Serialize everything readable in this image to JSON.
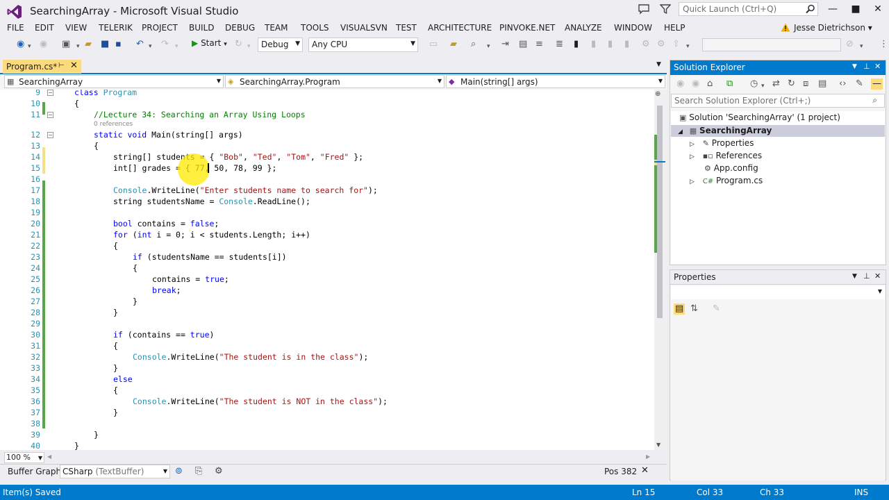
{
  "window": {
    "title": "SearchingArray - Microsoft Visual Studio",
    "quick_launch_placeholder": "Quick Launch (Ctrl+Q)"
  },
  "menu": {
    "items": [
      "FILE",
      "EDIT",
      "VIEW",
      "TELERIK",
      "PROJECT",
      "BUILD",
      "DEBUG",
      "TEAM",
      "TOOLS",
      "VISUALSVN",
      "TEST",
      "ARCHITECTURE",
      "PINVOKE.NET",
      "ANALYZE",
      "WINDOW",
      "HELP"
    ],
    "user": "Jesse Dietrichson"
  },
  "toolbar": {
    "start_label": "Start",
    "configuration": "Debug",
    "platform": "Any CPU"
  },
  "editor": {
    "active_tab": "Program.cs*",
    "nav_project": "SearchingArray",
    "nav_class": "SearchingArray.Program",
    "nav_member": "Main(string[] args)",
    "zoom": "100 %",
    "lines": [
      {
        "num": "9"
      },
      {
        "num": "10"
      },
      {
        "num": "11"
      },
      {
        "num": "12"
      },
      {
        "num": "13"
      },
      {
        "num": "14"
      },
      {
        "num": "15"
      },
      {
        "num": "16"
      },
      {
        "num": "17"
      },
      {
        "num": "18"
      },
      {
        "num": "19"
      },
      {
        "num": "20"
      },
      {
        "num": "21"
      },
      {
        "num": "22"
      },
      {
        "num": "23"
      },
      {
        "num": "24"
      },
      {
        "num": "25"
      },
      {
        "num": "26"
      },
      {
        "num": "27"
      },
      {
        "num": "28"
      },
      {
        "num": "29"
      },
      {
        "num": "30"
      },
      {
        "num": "31"
      },
      {
        "num": "32"
      },
      {
        "num": "33"
      },
      {
        "num": "34"
      },
      {
        "num": "35"
      },
      {
        "num": "36"
      },
      {
        "num": "37"
      },
      {
        "num": "38"
      },
      {
        "num": "39"
      },
      {
        "num": "40"
      }
    ],
    "code": {
      "l9_kw": "class",
      "l9_ty": "Program",
      "l10": "{",
      "l11": "//Lecture 34: Searching an Array Using Loops",
      "references": "0 references",
      "l12_kw1": "static",
      "l12_kw2": "void",
      "l12_rest": "Main(string[] args)",
      "l13": "{",
      "l14_a": "string[] students = { ",
      "l14_s1": "\"Bob\"",
      "l14_s2": "\"Ted\"",
      "l14_s3": "\"Tom\"",
      "l14_s4": "\"Fred\"",
      "l14_end": " };",
      "l15": "int[] grades = { 77, 50, 78, 99 };",
      "l17_ty": "Console",
      "l17_mid": ".WriteLine(",
      "l17_s": "\"Enter students name to search for\"",
      "l17_end": ");",
      "l18_a": "string studentsName = ",
      "l18_ty": "Console",
      "l18_end": ".ReadLine();",
      "l20_kw": "bool",
      "l20_mid": " contains = ",
      "l20_kw2": "false",
      "l20_end": ";",
      "l21_kw": "for",
      "l21_a": " (",
      "l21_kw2": "int",
      "l21_end": " i = 0; i < students.Length; i++)",
      "l22": "{",
      "l23_kw": "if",
      "l23_end": " (studentsName == students[i])",
      "l24": "{",
      "l25_a": "contains = ",
      "l25_kw": "true",
      "l25_end": ";",
      "l26_kw": "break",
      "l26_end": ";",
      "l27": "}",
      "l28": "}",
      "l30_kw": "if",
      "l30_a": " (contains == ",
      "l30_kw2": "true",
      "l30_end": ")",
      "l31": "{",
      "l32_ty": "Console",
      "l32_mid": ".WriteLine(",
      "l32_s": "\"The student is in the class\"",
      "l32_end": ");",
      "l33": "}",
      "l34_kw": "else",
      "l35": "{",
      "l36_ty": "Console",
      "l36_mid": ".WriteLine(",
      "l36_s": "\"The student is NOT in the class\"",
      "l36_end": ");",
      "l37": "}",
      "l39": "}",
      "l40": "}"
    }
  },
  "buffer": {
    "label": "Buffer Graph:",
    "value": "CSharp",
    "value_sub": "(TextBuffer)",
    "pos": "Pos 382"
  },
  "solution_explorer": {
    "title": "Solution Explorer",
    "search_placeholder": "Search Solution Explorer (Ctrl+;)",
    "solution": "Solution 'SearchingArray' (1 project)",
    "project": "SearchingArray",
    "items": [
      "Properties",
      "References",
      "App.config",
      "Program.cs"
    ]
  },
  "properties": {
    "title": "Properties"
  },
  "status": {
    "message": "Item(s) Saved",
    "ln": "Ln 15",
    "col": "Col 33",
    "ch": "Ch 33",
    "mode": "INS"
  },
  "colors": {
    "accent": "#007acc",
    "tab_active": "#fcdb7f",
    "keyword": "#0000ff",
    "type": "#2b91af",
    "string": "#a31515",
    "comment": "#008000"
  }
}
